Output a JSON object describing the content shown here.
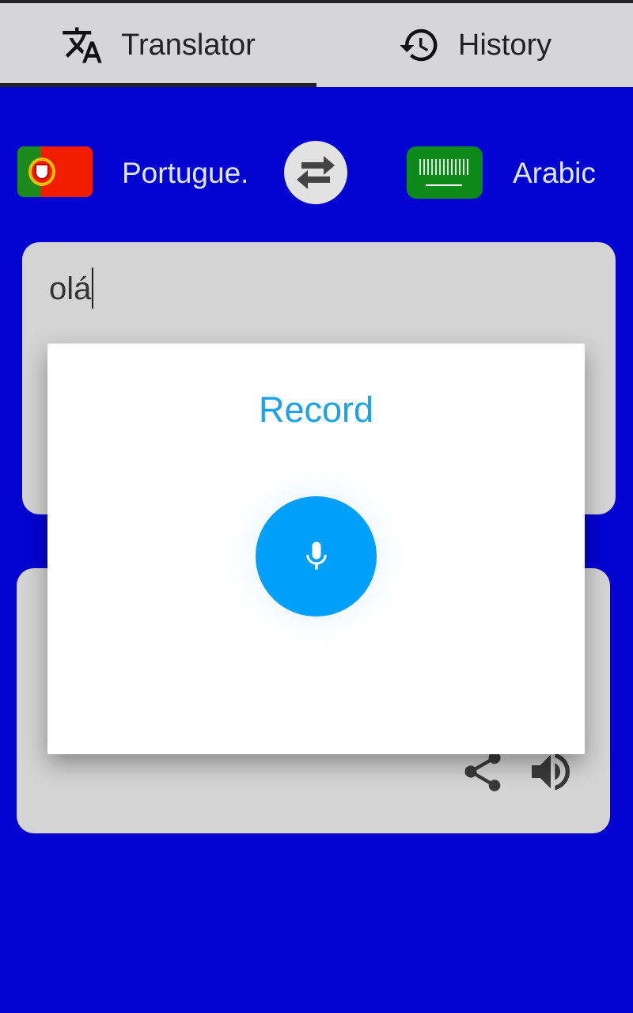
{
  "tabs": [
    {
      "label": "Translator",
      "icon": "translate-icon",
      "active": true
    },
    {
      "label": "History",
      "icon": "history-icon",
      "active": false
    }
  ],
  "languages": {
    "source": {
      "label": "Portugue.",
      "flag": "portugal-flag"
    },
    "target": {
      "label": "Arabic",
      "flag": "saudi-arabia-flag"
    },
    "swap_icon": "swap-icon"
  },
  "input": {
    "value": "olá"
  },
  "dialog": {
    "title": "Record",
    "mic_icon": "mic-icon"
  },
  "output": {
    "share_icon": "share-icon",
    "speaker_icon": "speaker-icon"
  },
  "colors": {
    "background": "#0303d2",
    "accent": "#00a0fa",
    "title": "#1ca3e6"
  }
}
